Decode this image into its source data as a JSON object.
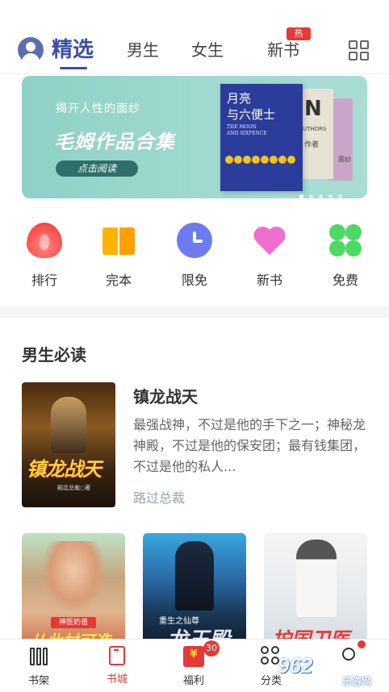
{
  "top_tabs": {
    "items": [
      "精选",
      "男生",
      "女生",
      "新书"
    ],
    "hot_badge": "热"
  },
  "banner": {
    "subtitle": "揭开人性的面纱",
    "title": "毛姆作品合集",
    "button": "点击阅读",
    "cover_title": "月亮\n与六便士",
    "cover_en": "THE MOON\nAND SIXPENCE",
    "back_cover_letters": "N",
    "back_cover_small": "UTHORS",
    "back_cover_tag": "作者",
    "back_cover2_tag": "面纱"
  },
  "categories": [
    {
      "label": "排行",
      "icon": "fire-icon"
    },
    {
      "label": "完本",
      "icon": "book-icon"
    },
    {
      "label": "限免",
      "icon": "clock-icon"
    },
    {
      "label": "新书",
      "icon": "heart-icon"
    },
    {
      "label": "免费",
      "icon": "clover-icon"
    }
  ],
  "section": {
    "title": "男生必读",
    "featured": {
      "title": "镇龙战天",
      "cover_title": "镇龙战天",
      "cover_author": "殿廷总裁○著",
      "description": "最强战神，不过是他的手下之一；神秘龙神殿，不过是他的保安团；最有钱集团，不过是他的私人...",
      "author": "路过总裁"
    },
    "books": [
      {
        "cover_caption": "神医奶爸",
        "cover_title": "从此村可造"
      },
      {
        "cover_caption": "重生之仙尊",
        "cover_title": "龙王殿"
      },
      {
        "cover_title": "护国卫医"
      }
    ]
  },
  "bottom_nav": {
    "items": [
      "书架",
      "书城",
      "福利",
      "分类",
      ""
    ],
    "active": "书城",
    "gift_badge": "30"
  },
  "watermark": {
    "main": "962",
    "sub": "乐游网"
  },
  "colors": {
    "accent": "#3a4fa5",
    "red": "#e53935",
    "banner_bg": "#9fd9cf"
  }
}
